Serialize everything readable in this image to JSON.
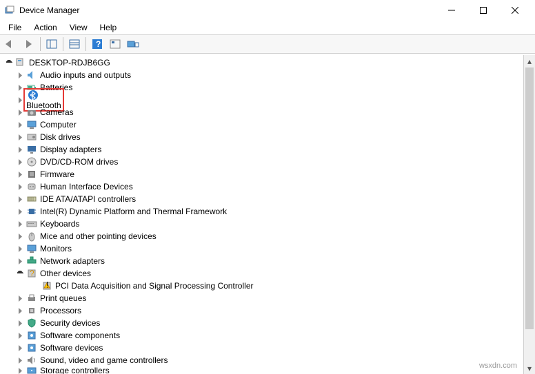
{
  "window": {
    "title": "Device Manager"
  },
  "menu": {
    "file": "File",
    "action": "Action",
    "view": "View",
    "help": "Help"
  },
  "tree": {
    "root": "DESKTOP-RDJB6GG",
    "items": [
      {
        "label": "Audio inputs and outputs",
        "icon": "audio"
      },
      {
        "label": "Batteries",
        "icon": "battery"
      },
      {
        "label": "Bluetooth",
        "icon": "bluetooth",
        "highlighted": true
      },
      {
        "label": "Cameras",
        "icon": "camera"
      },
      {
        "label": "Computer",
        "icon": "computer"
      },
      {
        "label": "Disk drives",
        "icon": "disk"
      },
      {
        "label": "Display adapters",
        "icon": "display"
      },
      {
        "label": "DVD/CD-ROM drives",
        "icon": "dvd"
      },
      {
        "label": "Firmware",
        "icon": "firmware"
      },
      {
        "label": "Human Interface Devices",
        "icon": "hid"
      },
      {
        "label": "IDE ATA/ATAPI controllers",
        "icon": "ide"
      },
      {
        "label": "Intel(R) Dynamic Platform and Thermal Framework",
        "icon": "chip"
      },
      {
        "label": "Keyboards",
        "icon": "keyboard"
      },
      {
        "label": "Mice and other pointing devices",
        "icon": "mouse"
      },
      {
        "label": "Monitors",
        "icon": "monitor"
      },
      {
        "label": "Network adapters",
        "icon": "network"
      },
      {
        "label": "Other devices",
        "icon": "other",
        "expanded": true,
        "children": [
          {
            "label": "PCI Data Acquisition and Signal Processing Controller",
            "icon": "warn"
          }
        ]
      },
      {
        "label": "Print queues",
        "icon": "printer"
      },
      {
        "label": "Processors",
        "icon": "cpu"
      },
      {
        "label": "Security devices",
        "icon": "security"
      },
      {
        "label": "Software components",
        "icon": "software"
      },
      {
        "label": "Software devices",
        "icon": "software"
      },
      {
        "label": "Sound, video and game controllers",
        "icon": "sound"
      },
      {
        "label": "Storage controllers",
        "icon": "storage",
        "partial": true
      }
    ]
  },
  "watermark": "wsxdn.com"
}
